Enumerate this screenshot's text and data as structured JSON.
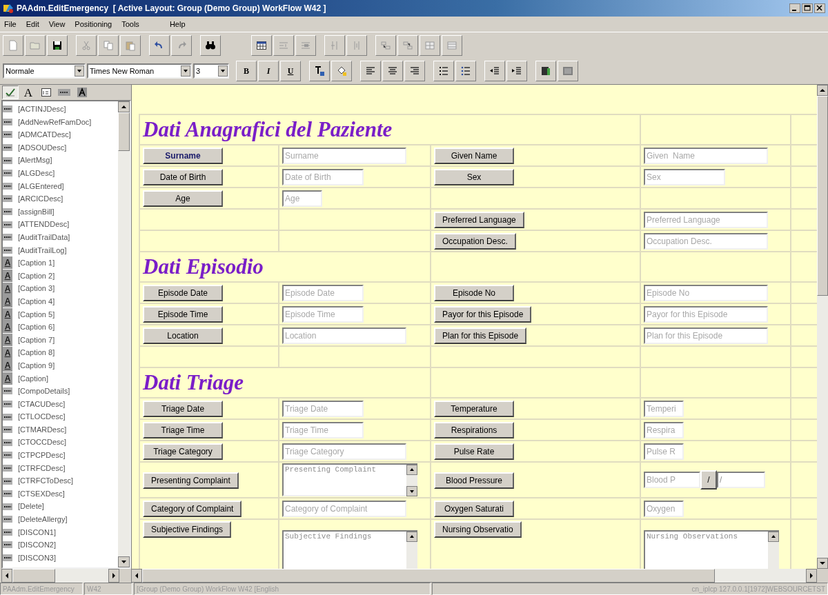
{
  "window": {
    "title": "PAAdm.EditEmergency  [ Active Layout: Group (Demo Group) WorkFlow W42 ]"
  },
  "menu": [
    "File",
    "Edit",
    "View",
    "Positioning",
    "Tools",
    "Help"
  ],
  "format_bar": {
    "style": "Normale",
    "font": "Times New Roman",
    "size": "3",
    "buttons": [
      {
        "label": "B",
        "kind": "bold"
      },
      {
        "label": "I",
        "kind": "italic"
      },
      {
        "label": "U",
        "kind": "underline"
      }
    ]
  },
  "palette": {
    "tabs": [
      {
        "kind": "check",
        "selected": true
      },
      {
        "kind": "letter",
        "glyph": "A",
        "selected": false
      },
      {
        "kind": "textbox",
        "selected": false
      },
      {
        "kind": "field",
        "selected": false
      },
      {
        "kind": "caption",
        "selected": false
      }
    ],
    "items": [
      {
        "kind": "field",
        "label": "[ACTINJDesc]"
      },
      {
        "kind": "field",
        "label": "[AddNewRefFamDoc]"
      },
      {
        "kind": "field",
        "label": "[ADMCATDesc]"
      },
      {
        "kind": "field",
        "label": "[ADSOUDesc]"
      },
      {
        "kind": "field",
        "label": "[AlertMsg]"
      },
      {
        "kind": "field",
        "label": "[ALGDesc]"
      },
      {
        "kind": "field",
        "label": "[ALGEntered]"
      },
      {
        "kind": "field",
        "label": "[ARCICDesc]"
      },
      {
        "kind": "field",
        "label": "[assignBill]"
      },
      {
        "kind": "field",
        "label": "[ATTENDDesc]"
      },
      {
        "kind": "field",
        "label": "[AuditTrailData]"
      },
      {
        "kind": "field",
        "label": "[AuditTrailLog]"
      },
      {
        "kind": "caption",
        "glyph": "A",
        "label": "[Caption 1]"
      },
      {
        "kind": "caption",
        "glyph": "A",
        "label": "[Caption 2]"
      },
      {
        "kind": "caption",
        "glyph": "A",
        "label": "[Caption 3]"
      },
      {
        "kind": "caption",
        "glyph": "A",
        "label": "[Caption 4]"
      },
      {
        "kind": "caption",
        "glyph": "A",
        "label": "[Caption 5]"
      },
      {
        "kind": "caption",
        "glyph": "A",
        "label": "[Caption 6]"
      },
      {
        "kind": "caption",
        "glyph": "A",
        "label": "[Caption 7]"
      },
      {
        "kind": "caption",
        "glyph": "A",
        "label": "[Caption 8]"
      },
      {
        "kind": "caption",
        "glyph": "A",
        "label": "[Caption 9]"
      },
      {
        "kind": "caption",
        "glyph": "A",
        "label": "[Caption]"
      },
      {
        "kind": "field",
        "label": "[CompoDetails]"
      },
      {
        "kind": "field",
        "label": "[CTACUDesc]"
      },
      {
        "kind": "field",
        "label": "[CTLOCDesc]"
      },
      {
        "kind": "field",
        "label": "[CTMARDesc]"
      },
      {
        "kind": "field",
        "label": "[CTOCCDesc]"
      },
      {
        "kind": "field",
        "label": "[CTPCPDesc]"
      },
      {
        "kind": "field",
        "label": "[CTRFCDesc]"
      },
      {
        "kind": "field",
        "label": "[CTRFCToDesc]"
      },
      {
        "kind": "field",
        "label": "[CTSEXDesc]"
      },
      {
        "kind": "field",
        "label": "[Delete]"
      },
      {
        "kind": "field",
        "label": "[DeleteAllergy]"
      },
      {
        "kind": "field",
        "label": "[DISCON1]"
      },
      {
        "kind": "field",
        "label": "[DISCON2]"
      },
      {
        "kind": "field",
        "label": "[DISCON3]"
      }
    ]
  },
  "form": {
    "sections": [
      {
        "title": "Dati Anagrafici del Paziente",
        "wide": true,
        "rows": [
          {
            "cells": [
              {
                "kind": "button",
                "label": "Surname",
                "bold": true
              },
              {
                "kind": "long_input",
                "placeholder": "Surname"
              },
              {
                "kind": "button",
                "label": "Given  Name",
                "bold": false
              },
              {
                "kind": "long_input",
                "placeholder": "Given  Name"
              }
            ]
          },
          {
            "cells": [
              {
                "kind": "button",
                "label": "Date of Birth",
                "bold": false
              },
              {
                "kind": "medium_input",
                "placeholder": "Date of Birth"
              },
              {
                "kind": "button",
                "label": "Sex",
                "bold": false
              },
              {
                "kind": "medium_input",
                "placeholder": "Sex"
              }
            ]
          },
          {
            "cells": [
              {
                "kind": "button",
                "label": "Age",
                "bold": false
              },
              {
                "kind": "short_input",
                "placeholder": "Age"
              },
              {
                "kind": "empty"
              },
              {
                "kind": "empty"
              }
            ]
          },
          {
            "cells": [
              {
                "kind": "empty"
              },
              {
                "kind": "empty"
              },
              {
                "kind": "button",
                "label": "Preferred Language",
                "bold": false
              },
              {
                "kind": "long_input",
                "placeholder": "Preferred Language"
              }
            ]
          },
          {
            "cells": [
              {
                "kind": "empty"
              },
              {
                "kind": "empty"
              },
              {
                "kind": "button",
                "label": "Occupation Desc.",
                "bold": false
              },
              {
                "kind": "long_input",
                "placeholder": "Occupation Desc."
              }
            ]
          }
        ]
      },
      {
        "title": "Dati Episodio",
        "wide": false,
        "rows": [
          {
            "cells": [
              {
                "kind": "button",
                "label": "Episode Date",
                "bold": false
              },
              {
                "kind": "medium_input",
                "placeholder": "Episode Date"
              },
              {
                "kind": "button",
                "label": "Episode No",
                "bold": false
              },
              {
                "kind": "long_input",
                "placeholder": "Episode No"
              }
            ]
          },
          {
            "cells": [
              {
                "kind": "button",
                "label": "Episode Time",
                "bold": false
              },
              {
                "kind": "medium_input",
                "placeholder": "Episode Time"
              },
              {
                "kind": "button",
                "label": "Payor for this Episode",
                "bold": false
              },
              {
                "kind": "long_input",
                "placeholder": "Payor for this Episode"
              }
            ]
          },
          {
            "cells": [
              {
                "kind": "button",
                "label": "Location",
                "bold": false
              },
              {
                "kind": "long_input",
                "placeholder": "Location"
              },
              {
                "kind": "button",
                "label": "Plan for this Episode",
                "bold": false
              },
              {
                "kind": "long_input",
                "placeholder": "Plan for this Episode"
              }
            ]
          },
          {
            "cells": [
              {
                "kind": "empty"
              },
              {
                "kind": "empty"
              },
              {
                "kind": "empty"
              },
              {
                "kind": "empty"
              }
            ]
          }
        ]
      },
      {
        "title": "Dati Triage",
        "wide": false,
        "rows": [
          {
            "cells": [
              {
                "kind": "button",
                "label": "Triage Date",
                "bold": false
              },
              {
                "kind": "medium_input",
                "placeholder": "Triage Date"
              },
              {
                "kind": "button",
                "label": "Temperature",
                "bold": false
              },
              {
                "kind": "short_input",
                "placeholder": "Temperi"
              }
            ]
          },
          {
            "cells": [
              {
                "kind": "button",
                "label": "Triage Time",
                "bold": false
              },
              {
                "kind": "medium_input",
                "placeholder": "Triage Time"
              },
              {
                "kind": "button",
                "label": "Respirations",
                "bold": false
              },
              {
                "kind": "short_input",
                "placeholder": "Respira"
              }
            ]
          },
          {
            "cells": [
              {
                "kind": "button",
                "label": "Triage Category",
                "bold": false
              },
              {
                "kind": "long_input",
                "placeholder": "Triage Category"
              },
              {
                "kind": "button",
                "label": "Pulse Rate",
                "bold": false
              },
              {
                "kind": "short_input",
                "placeholder": "Pulse R"
              }
            ]
          },
          {
            "cells": [
              {
                "kind": "button",
                "label": "Presenting Complaint",
                "bold": false
              },
              {
                "kind": "textarea",
                "placeholder": "Presenting Complaint"
              },
              {
                "kind": "button",
                "label": "Blood Pressure",
                "bold": false
              },
              {
                "kind": "bp",
                "placeholder": "Blood P",
                "button": "/",
                "value": "/"
              }
            ]
          },
          {
            "cells": [
              {
                "kind": "button",
                "label": "Category of Complaint",
                "bold": false
              },
              {
                "kind": "long_input",
                "placeholder": "Category of Complaint"
              },
              {
                "kind": "button",
                "label": "Oxygen Saturati",
                "bold": false
              },
              {
                "kind": "short_input",
                "placeholder": "Oxygen"
              }
            ]
          },
          {
            "cells": [
              {
                "kind": "button",
                "label": "Subjective Findings",
                "bold": false
              },
              {
                "kind": "textarea",
                "placeholder": "Subjective Findings"
              },
              {
                "kind": "button",
                "label": "Nursing Observatio",
                "bold": false
              },
              {
                "kind": "textarea",
                "placeholder": "Nursing Observations"
              }
            ]
          }
        ]
      }
    ]
  },
  "status_bar": [
    "PAAdm.EditEmergency",
    "W42",
    "[Group (Demo Group) WorkFlow W42 [English",
    "cn_iplcp 127.0.0.1[1972]WEBSOURCETST"
  ]
}
